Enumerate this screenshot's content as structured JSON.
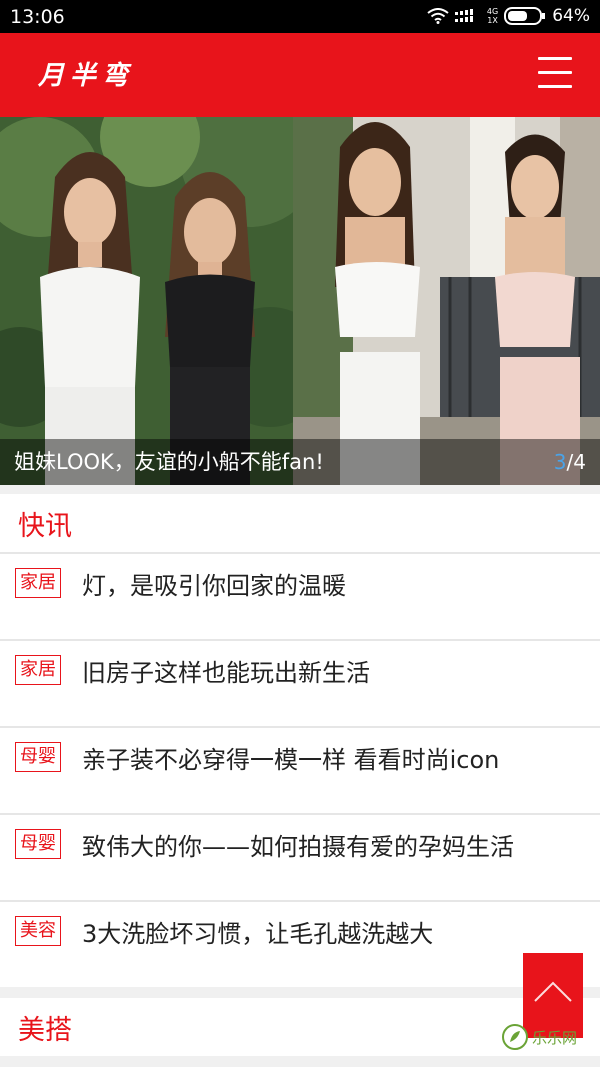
{
  "status_bar": {
    "time": "13:06",
    "network_top": "4G",
    "network_bottom": "1X",
    "battery": "64%",
    "battery_level": 0.64
  },
  "header": {
    "logo": "月半弯",
    "menu_icon": "hamburger-menu-icon",
    "brand_color": "#e8141b"
  },
  "banner": {
    "caption": "姐妹LOOK，友谊的小船不能fan!",
    "current": "3",
    "separator": "/",
    "total": "4"
  },
  "sections": {
    "news_title": "快讯",
    "style_title": "美搭"
  },
  "news": [
    {
      "tag": "家居",
      "title": "灯，是吸引你回家的温暖"
    },
    {
      "tag": "家居",
      "title": "旧房子这样也能玩出新生活"
    },
    {
      "tag": "母婴",
      "title": "亲子装不必穿得一模一样 看看时尚icon"
    },
    {
      "tag": "母婴",
      "title": "致伟大的你——如何拍摄有爱的孕妈生活"
    },
    {
      "tag": "美容",
      "title": "3大洗脸坏习惯，让毛孔越洗越大"
    }
  ],
  "back_to_top_icon": "chevron-up-icon",
  "watermark": "乐乐网"
}
